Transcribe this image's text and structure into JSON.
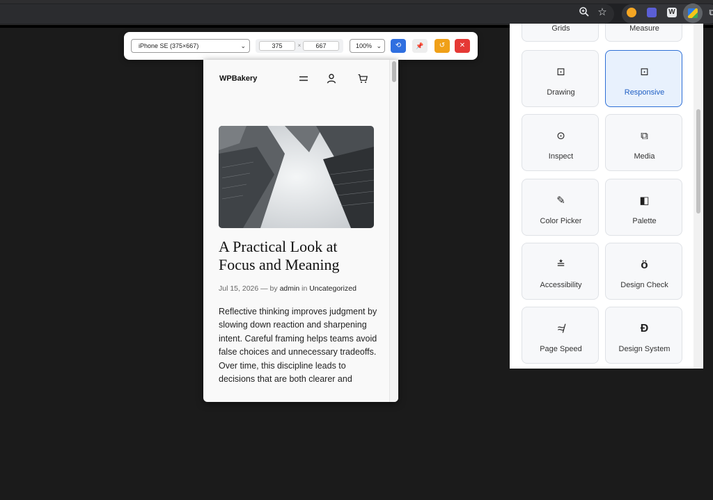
{
  "browser": {
    "icons": [
      "zoom-icon",
      "star-icon",
      "extension-orange-icon",
      "extension-purple-icon",
      "extension-w-icon",
      "extension-active-icon",
      "puzzle-icon"
    ],
    "ext_w_label": "W"
  },
  "toolbar": {
    "device_value": "iPhone SE (375×667)",
    "width_value": "375",
    "dim_separator": "×",
    "height_value": "667",
    "zoom_value": "100%",
    "buttons": [
      {
        "name": "rotate-button",
        "glyph": "⟲",
        "color": "#2f6fe0"
      },
      {
        "name": "pin-button",
        "glyph": "📌",
        "color": "#eeeeee"
      },
      {
        "name": "reload-button",
        "glyph": "↺",
        "color": "#f0a018"
      },
      {
        "name": "close-button",
        "glyph": "✕",
        "color": "#e53935"
      }
    ]
  },
  "site": {
    "logo": "WPBakery",
    "post_title": "A Practical Look at Focus and Meaning",
    "meta_date": "Jul 15, 2026",
    "meta_by": "— by",
    "meta_author": "admin",
    "meta_in": "in",
    "meta_category": "Uncategorized",
    "body": "Reflective thinking improves judgment by slowing down reaction and sharpening intent. Careful framing helps teams avoid false choices and unnecessary tradeoffs. Over time, this discipline leads to decisions that are both clearer and"
  },
  "panel": {
    "tiles": [
      {
        "label": "Grids",
        "icon": "",
        "active": false
      },
      {
        "label": "Measure",
        "icon": "",
        "active": false
      },
      {
        "label": "Drawing",
        "icon": "⊡",
        "active": false
      },
      {
        "label": "Responsive",
        "icon": "⊡",
        "active": true
      },
      {
        "label": "Inspect",
        "icon": "⊙",
        "active": false
      },
      {
        "label": "Media",
        "icon": "⧉",
        "active": false
      },
      {
        "label": "Color Picker",
        "icon": "✎",
        "active": false
      },
      {
        "label": "Palette",
        "icon": "◧",
        "active": false
      },
      {
        "label": "Accessibility",
        "icon": "≛",
        "active": false
      },
      {
        "label": "Design Check",
        "icon": "ö",
        "active": false
      },
      {
        "label": "Page Speed",
        "icon": "≉",
        "active": false
      },
      {
        "label": "Design System",
        "icon": "Ð",
        "active": false
      }
    ]
  }
}
